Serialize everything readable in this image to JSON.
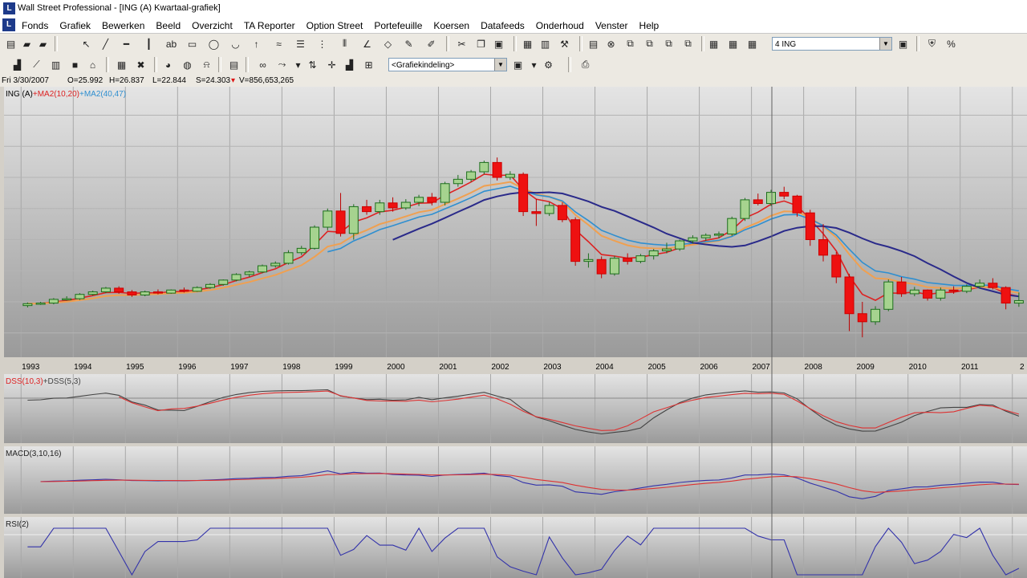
{
  "window": {
    "title": "Wall Street Professional - [ING (A) Kwartaal-grafiek]",
    "app_icon": "L"
  },
  "menu": [
    "Fonds",
    "Grafiek",
    "Bewerken",
    "Beeld",
    "Overzicht",
    "TA Reporter",
    "Option Street",
    "Portefeuille",
    "Koersen",
    "Datafeeds",
    "Onderhoud",
    "Venster",
    "Help"
  ],
  "toolbar1": {
    "symbol_combo": "4 ING"
  },
  "toolbar2": {
    "layout_combo": "<Grafiekindeling>"
  },
  "infobar": {
    "date": "Fri 3/30/2007",
    "open": "O=25.992",
    "high": "H=26.837",
    "low": "L=22.844",
    "close": "S=24.303",
    "volume": "V=856,653,265"
  },
  "colors": {
    "up": "#2e9b2e",
    "down": "#ee1111",
    "ma_fast": "#dd2222",
    "ma_slow": "#f0a050",
    "ma2_fast": "#2f8fd0",
    "ma2_slow": "#2a2a8a",
    "dss_main": "#444444",
    "dss_signal": "#dd3333",
    "macd": "#3333aa",
    "macd_signal": "#dd3333",
    "rsi": "#3333aa"
  },
  "panels": {
    "price": {
      "label_parts": [
        "ING (A)",
        "+MA2(10,20)",
        "+MA2(40,47)"
      ],
      "x_labels": [
        "1993",
        "1994",
        "1995",
        "1996",
        "1997",
        "1998",
        "1999",
        "2000",
        "2001",
        "2002",
        "2003",
        "2004",
        "2005",
        "2006",
        "2007",
        "2008",
        "2009",
        "2010",
        "2011",
        "2"
      ]
    },
    "dss": {
      "label_parts": [
        "DSS(10,3)",
        "+DSS(5,3)"
      ]
    },
    "macd": {
      "label": "MACD(3,10,16)"
    },
    "rsi": {
      "label": "RSI(2)"
    }
  },
  "chart_data": {
    "type": "candlestick",
    "period": "quarterly",
    "candles": [
      {
        "q": "1993Q1",
        "o": 9.4,
        "h": 9.9,
        "l": 9.1,
        "c": 9.7
      },
      {
        "q": "1993Q2",
        "o": 9.7,
        "h": 10.0,
        "l": 9.5,
        "c": 9.8
      },
      {
        "q": "1993Q3",
        "o": 9.8,
        "h": 10.6,
        "l": 9.6,
        "c": 10.4
      },
      {
        "q": "1993Q4",
        "o": 10.4,
        "h": 10.9,
        "l": 10.2,
        "c": 10.5
      },
      {
        "q": "1994Q1",
        "o": 10.5,
        "h": 11.4,
        "l": 10.3,
        "c": 11.2
      },
      {
        "q": "1994Q2",
        "o": 11.2,
        "h": 11.8,
        "l": 11.0,
        "c": 11.6
      },
      {
        "q": "1994Q3",
        "o": 11.6,
        "h": 12.4,
        "l": 11.4,
        "c": 12.2
      },
      {
        "q": "1994Q4",
        "o": 12.2,
        "h": 12.5,
        "l": 11.3,
        "c": 11.6
      },
      {
        "q": "1995Q1",
        "o": 11.6,
        "h": 11.9,
        "l": 10.8,
        "c": 11.1
      },
      {
        "q": "1995Q2",
        "o": 11.1,
        "h": 11.8,
        "l": 10.9,
        "c": 11.6
      },
      {
        "q": "1995Q3",
        "o": 11.6,
        "h": 12.0,
        "l": 11.2,
        "c": 11.4
      },
      {
        "q": "1995Q4",
        "o": 11.4,
        "h": 12.0,
        "l": 11.3,
        "c": 11.9
      },
      {
        "q": "1996Q1",
        "o": 11.9,
        "h": 12.3,
        "l": 11.5,
        "c": 11.7
      },
      {
        "q": "1996Q2",
        "o": 11.7,
        "h": 12.5,
        "l": 11.6,
        "c": 12.3
      },
      {
        "q": "1996Q3",
        "o": 12.3,
        "h": 13.0,
        "l": 12.1,
        "c": 12.8
      },
      {
        "q": "1996Q4",
        "o": 12.8,
        "h": 13.6,
        "l": 12.6,
        "c": 13.5
      },
      {
        "q": "1997Q1",
        "o": 13.5,
        "h": 14.6,
        "l": 13.3,
        "c": 14.4
      },
      {
        "q": "1997Q2",
        "o": 14.4,
        "h": 15.0,
        "l": 14.0,
        "c": 14.8
      },
      {
        "q": "1997Q3",
        "o": 14.8,
        "h": 16.0,
        "l": 14.6,
        "c": 15.8
      },
      {
        "q": "1997Q4",
        "o": 15.8,
        "h": 16.5,
        "l": 15.5,
        "c": 16.2
      },
      {
        "q": "1998Q1",
        "o": 16.2,
        "h": 18.3,
        "l": 16.0,
        "c": 17.9
      },
      {
        "q": "1998Q2",
        "o": 17.9,
        "h": 19.0,
        "l": 17.5,
        "c": 18.6
      },
      {
        "q": "1998Q3",
        "o": 18.6,
        "h": 22.3,
        "l": 18.4,
        "c": 22.0
      },
      {
        "q": "1998Q4",
        "o": 22.0,
        "h": 25.0,
        "l": 21.5,
        "c": 24.6
      },
      {
        "q": "1999Q1",
        "o": 24.6,
        "h": 27.5,
        "l": 20.5,
        "c": 21.0
      },
      {
        "q": "1999Q2",
        "o": 21.0,
        "h": 25.7,
        "l": 20.0,
        "c": 25.3
      },
      {
        "q": "1999Q3",
        "o": 25.3,
        "h": 26.4,
        "l": 24.0,
        "c": 24.5
      },
      {
        "q": "1999Q4",
        "o": 24.5,
        "h": 26.4,
        "l": 24.0,
        "c": 25.9
      },
      {
        "q": "2000Q1",
        "o": 25.9,
        "h": 26.8,
        "l": 24.5,
        "c": 25.1
      },
      {
        "q": "2000Q2",
        "o": 25.1,
        "h": 26.5,
        "l": 24.8,
        "c": 26.0
      },
      {
        "q": "2000Q3",
        "o": 26.0,
        "h": 27.2,
        "l": 25.4,
        "c": 26.8
      },
      {
        "q": "2000Q4",
        "o": 26.8,
        "h": 27.5,
        "l": 25.5,
        "c": 26.0
      },
      {
        "q": "2001Q1",
        "o": 26.0,
        "h": 29.3,
        "l": 25.5,
        "c": 29.0
      },
      {
        "q": "2001Q2",
        "o": 29.0,
        "h": 30.4,
        "l": 28.5,
        "c": 29.7
      },
      {
        "q": "2001Q3",
        "o": 29.7,
        "h": 31.2,
        "l": 29.3,
        "c": 30.9
      },
      {
        "q": "2001Q4",
        "o": 30.9,
        "h": 32.7,
        "l": 30.5,
        "c": 32.4
      },
      {
        "q": "2002Q1",
        "o": 32.4,
        "h": 33.2,
        "l": 29.5,
        "c": 30.0
      },
      {
        "q": "2002Q2",
        "o": 30.0,
        "h": 31.0,
        "l": 29.6,
        "c": 30.5
      },
      {
        "q": "2002Q3",
        "o": 30.5,
        "h": 30.8,
        "l": 23.8,
        "c": 24.5
      },
      {
        "q": "2002Q4",
        "o": 24.5,
        "h": 26.5,
        "l": 22.2,
        "c": 24.2
      },
      {
        "q": "2003Q1",
        "o": 24.2,
        "h": 26.0,
        "l": 23.8,
        "c": 25.5
      },
      {
        "q": "2003Q2",
        "o": 25.5,
        "h": 26.0,
        "l": 22.8,
        "c": 23.2
      },
      {
        "q": "2003Q3",
        "o": 23.2,
        "h": 23.6,
        "l": 15.8,
        "c": 16.5
      },
      {
        "q": "2003Q4",
        "o": 16.5,
        "h": 17.8,
        "l": 15.5,
        "c": 16.8
      },
      {
        "q": "2004Q1",
        "o": 16.8,
        "h": 17.3,
        "l": 13.8,
        "c": 14.5
      },
      {
        "q": "2004Q2",
        "o": 14.5,
        "h": 17.4,
        "l": 14.2,
        "c": 17.0
      },
      {
        "q": "2004Q3",
        "o": 17.0,
        "h": 17.8,
        "l": 16.0,
        "c": 16.5
      },
      {
        "q": "2004Q4",
        "o": 16.5,
        "h": 17.7,
        "l": 16.2,
        "c": 17.4
      },
      {
        "q": "2005Q1",
        "o": 17.4,
        "h": 18.5,
        "l": 16.8,
        "c": 18.2
      },
      {
        "q": "2005Q2",
        "o": 18.2,
        "h": 19.5,
        "l": 17.8,
        "c": 18.5
      },
      {
        "q": "2005Q3",
        "o": 18.5,
        "h": 20.0,
        "l": 18.2,
        "c": 19.8
      },
      {
        "q": "2005Q4",
        "o": 19.8,
        "h": 20.7,
        "l": 19.4,
        "c": 20.3
      },
      {
        "q": "2006Q1",
        "o": 20.3,
        "h": 21.0,
        "l": 19.8,
        "c": 20.7
      },
      {
        "q": "2006Q2",
        "o": 20.7,
        "h": 21.3,
        "l": 20.2,
        "c": 20.9
      },
      {
        "q": "2006Q3",
        "o": 20.9,
        "h": 23.7,
        "l": 20.6,
        "c": 23.4
      },
      {
        "q": "2006Q4",
        "o": 23.4,
        "h": 26.7,
        "l": 23.0,
        "c": 26.4
      },
      {
        "q": "2007Q1",
        "o": 26.4,
        "h": 27.4,
        "l": 25.5,
        "c": 25.8
      },
      {
        "q": "2007Q2",
        "o": 25.8,
        "h": 28.0,
        "l": 25.4,
        "c": 27.6
      },
      {
        "q": "2007Q3",
        "o": 27.6,
        "h": 28.5,
        "l": 26.5,
        "c": 27.0
      },
      {
        "q": "2007Q4",
        "o": 27.0,
        "h": 27.2,
        "l": 23.7,
        "c": 24.3
      },
      {
        "q": "2008Q1",
        "o": 24.3,
        "h": 24.8,
        "l": 19.0,
        "c": 20.0
      },
      {
        "q": "2008Q2",
        "o": 20.0,
        "h": 22.5,
        "l": 16.5,
        "c": 17.5
      },
      {
        "q": "2008Q3",
        "o": 17.5,
        "h": 18.0,
        "l": 13.0,
        "c": 14.0
      },
      {
        "q": "2008Q4",
        "o": 14.0,
        "h": 14.5,
        "l": 5.3,
        "c": 8.1
      },
      {
        "q": "2009Q1",
        "o": 8.1,
        "h": 10.0,
        "l": 4.3,
        "c": 6.8
      },
      {
        "q": "2009Q2",
        "o": 6.8,
        "h": 9.3,
        "l": 6.3,
        "c": 8.8
      },
      {
        "q": "2009Q3",
        "o": 8.8,
        "h": 13.6,
        "l": 8.5,
        "c": 13.2
      },
      {
        "q": "2009Q4",
        "o": 13.2,
        "h": 14.0,
        "l": 10.8,
        "c": 11.3
      },
      {
        "q": "2010Q1",
        "o": 11.3,
        "h": 12.4,
        "l": 10.9,
        "c": 11.9
      },
      {
        "q": "2010Q2",
        "o": 11.9,
        "h": 12.0,
        "l": 10.2,
        "c": 10.6
      },
      {
        "q": "2010Q3",
        "o": 10.6,
        "h": 12.3,
        "l": 10.2,
        "c": 11.9
      },
      {
        "q": "2010Q4",
        "o": 11.9,
        "h": 12.5,
        "l": 11.3,
        "c": 11.7
      },
      {
        "q": "2011Q1",
        "o": 11.7,
        "h": 12.8,
        "l": 11.4,
        "c": 12.5
      },
      {
        "q": "2011Q2",
        "o": 12.5,
        "h": 13.6,
        "l": 12.1,
        "c": 13.0
      },
      {
        "q": "2011Q3",
        "o": 13.0,
        "h": 13.8,
        "l": 12.0,
        "c": 12.3
      },
      {
        "q": "2011Q4",
        "o": 12.3,
        "h": 12.5,
        "l": 8.8,
        "c": 9.8
      },
      {
        "q": "2012Q1",
        "o": 9.8,
        "h": 11.5,
        "l": 9.2,
        "c": 10.2
      }
    ],
    "ylim": [
      2,
      42
    ],
    "x_start_year": 1992.75,
    "x_end_year": 2012.25
  }
}
